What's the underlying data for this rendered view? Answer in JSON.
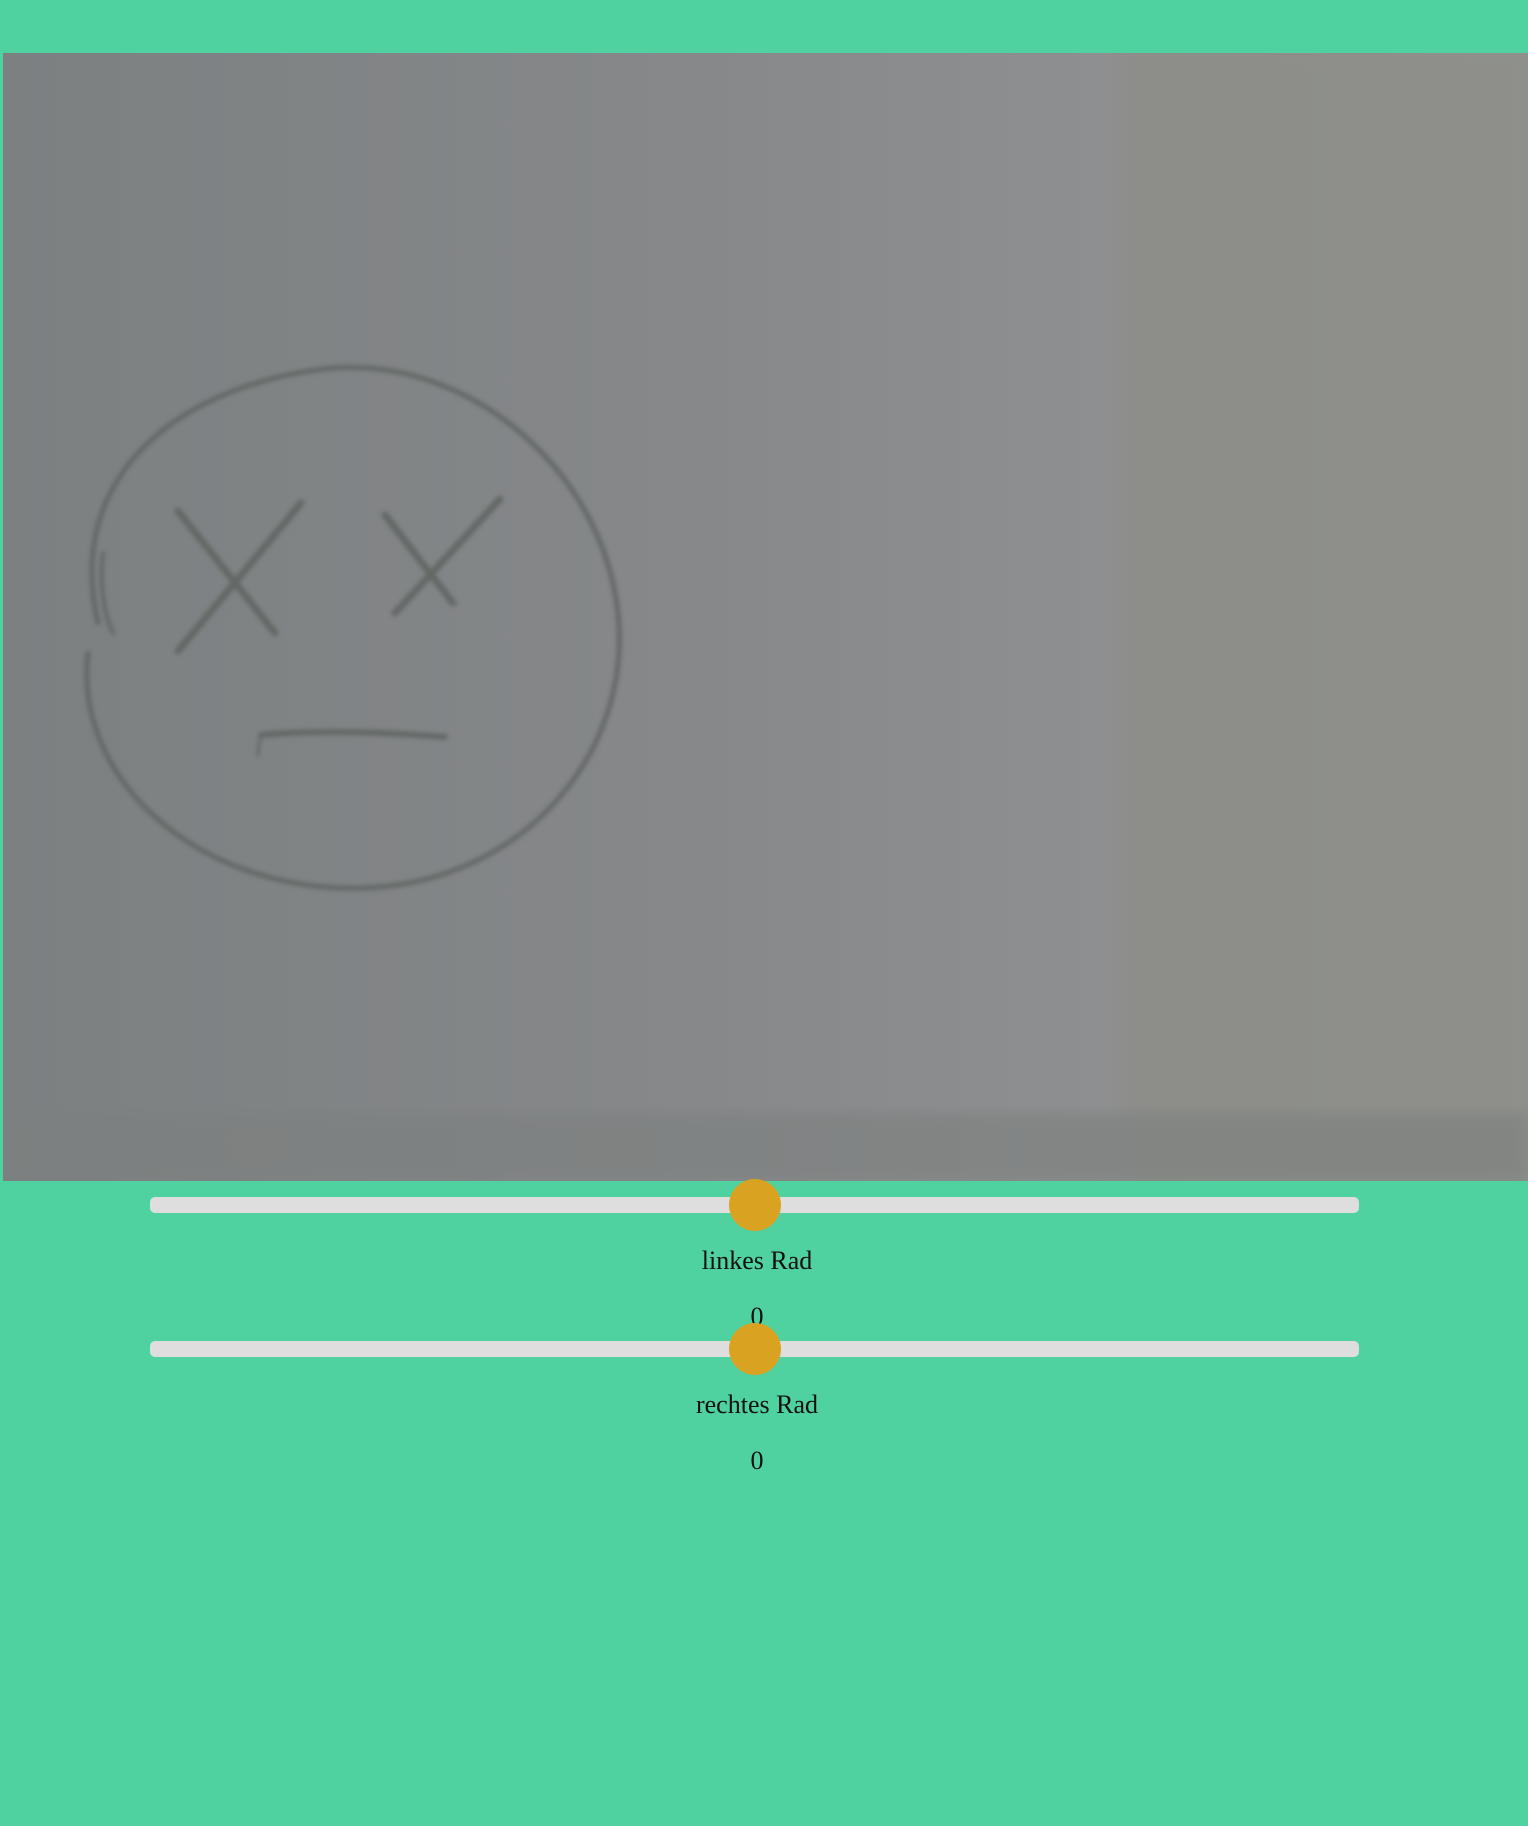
{
  "camera": {
    "icon": "camera-feed-image"
  },
  "controls": {
    "left_wheel": {
      "label": "linkes Rad",
      "value": "0",
      "slider_fraction": 0.5
    },
    "right_wheel": {
      "label": "rechtes Rad",
      "value": "0",
      "slider_fraction": 0.5
    }
  },
  "colors": {
    "background": "#50d1a0",
    "slider_track": "#dedede",
    "slider_thumb": "#d9a321"
  }
}
